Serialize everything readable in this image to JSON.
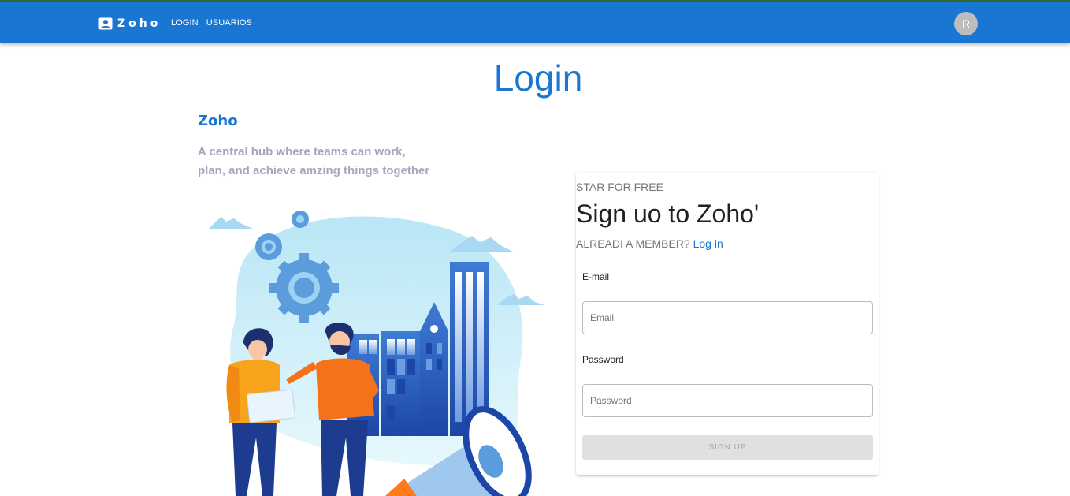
{
  "appbar": {
    "brand": "Zoho",
    "nav": [
      "LOGIN",
      "USUARIOS"
    ],
    "avatar_initial": "R",
    "color": "#1976d2"
  },
  "page": {
    "title": "Login",
    "brand_heading": "Zoho",
    "tagline": "A central hub where teams can work, plan, and achieve amzing things together"
  },
  "signup_card": {
    "kicker": "STAR FOR FREE",
    "title": "Sign uo to Zoho'",
    "member_text": "ALREADI A MEMBER?",
    "login_link": "Log in",
    "email_label": "E-mail",
    "email_placeholder": "Email",
    "password_label": "Password",
    "password_placeholder": "Password",
    "submit_label": "SIGN UP"
  },
  "icons": [
    "account-box-icon",
    "gear-icon"
  ]
}
